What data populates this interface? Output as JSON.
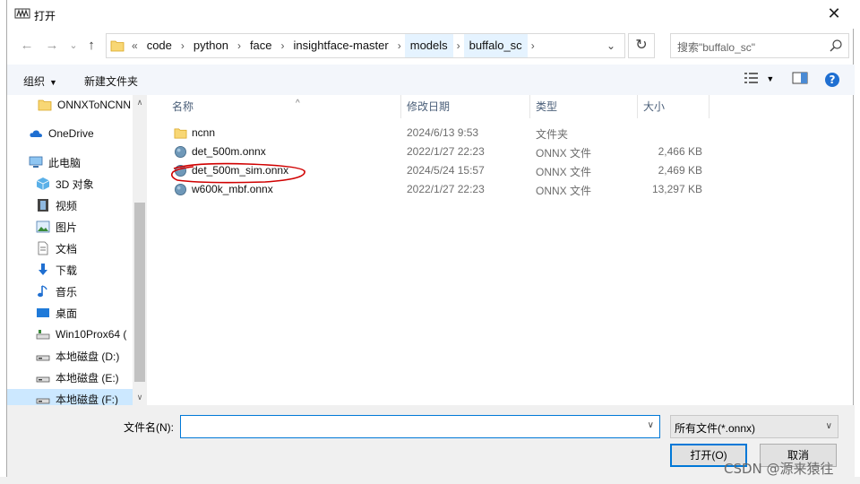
{
  "window": {
    "title": "打开",
    "close_glyph": "✕"
  },
  "nav": {
    "back": "←",
    "forward": "→",
    "dropdown": "⌄",
    "up": "↑"
  },
  "address": {
    "overflow": "«",
    "crumbs": [
      "code",
      "python",
      "face",
      "insightface-master",
      "models",
      "buffalo_sc"
    ],
    "separator": "›",
    "dropdown": "⌄"
  },
  "refresh_glyph": "↻",
  "search": {
    "placeholder": "搜索\"buffalo_sc\""
  },
  "toolbar": {
    "organize": "组织",
    "new_folder": "新建文件夹",
    "caret": "▼",
    "help": "?"
  },
  "sidebar": {
    "items": [
      {
        "label": "ONNXToNCNN",
        "icon": "folder-icon"
      },
      {
        "label": "OneDrive",
        "icon": "cloud-icon"
      },
      {
        "label": "此电脑",
        "icon": "computer-icon"
      },
      {
        "label": "3D 对象",
        "icon": "cube-icon"
      },
      {
        "label": "视频",
        "icon": "video-icon"
      },
      {
        "label": "图片",
        "icon": "picture-icon"
      },
      {
        "label": "文档",
        "icon": "document-icon"
      },
      {
        "label": "下载",
        "icon": "download-icon"
      },
      {
        "label": "音乐",
        "icon": "music-icon"
      },
      {
        "label": "桌面",
        "icon": "desktop-icon"
      },
      {
        "label": "Win10Prox64 (",
        "icon": "network-drive-icon"
      },
      {
        "label": "本地磁盘 (D:)",
        "icon": "drive-icon"
      },
      {
        "label": "本地磁盘 (E:)",
        "icon": "drive-icon"
      },
      {
        "label": "本地磁盘 (F:)",
        "icon": "drive-icon"
      }
    ],
    "selected_index": 13
  },
  "columns": {
    "name": "名称",
    "date": "修改日期",
    "type": "类型",
    "size": "大小"
  },
  "files": [
    {
      "name": "ncnn",
      "date": "2024/6/13 9:53",
      "type": "文件夹",
      "size": "",
      "icon": "folder-icon"
    },
    {
      "name": "det_500m.onnx",
      "date": "2022/1/27 22:23",
      "type": "ONNX 文件",
      "size": "2,466 KB",
      "icon": "onnx-file-icon"
    },
    {
      "name": "det_500m_sim.onnx",
      "date": "2024/5/24 15:57",
      "type": "ONNX 文件",
      "size": "2,469 KB",
      "icon": "onnx-file-icon"
    },
    {
      "name": "w600k_mbf.onnx",
      "date": "2022/1/27 22:23",
      "type": "ONNX 文件",
      "size": "13,297 KB",
      "icon": "onnx-file-icon"
    }
  ],
  "bottom": {
    "filename_label": "文件名(N):",
    "filename_value": "",
    "filetype": "所有文件(*.onnx)",
    "open": "打开(O)",
    "cancel": "取消"
  },
  "watermark": "CSDN @源来猿往",
  "colors": {
    "accent": "#0078d7",
    "selection": "#cce8ff",
    "highlight_circle": "#d00000",
    "folder": "#f8d775"
  }
}
